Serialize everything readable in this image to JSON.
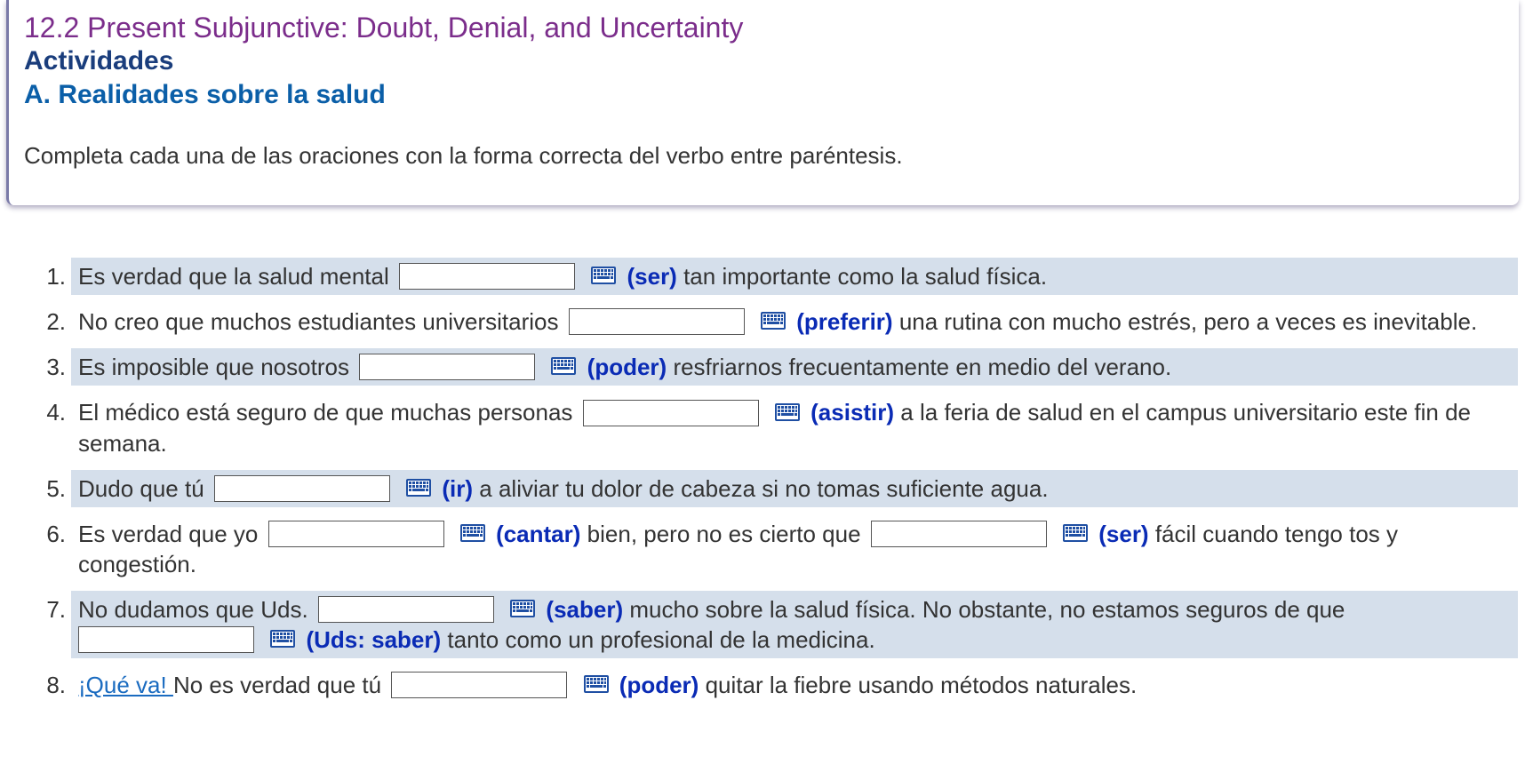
{
  "header": {
    "section_title": "12.2 Present Subjunctive: Doubt, Denial, and Uncertainty",
    "activities_label": "Actividades",
    "activity_title": "A. Realidades sobre la salud",
    "instructions": "Completa cada una de las oraciones con la forma correcta del verbo entre paréntesis."
  },
  "colors": {
    "section_title": "#7b2d8b",
    "activities_heading": "#1a3d7c",
    "activity_title": "#0b5fa8",
    "verb_hint": "#0a2bb5",
    "link": "#1a6bc0",
    "shaded_row": "#d5dfeb"
  },
  "icons": {
    "keyboard": "keyboard-icon"
  },
  "exercises": [
    {
      "number": "1.",
      "text_before": "Es verdad que la salud mental",
      "input1_value": "",
      "hint1": "(ser)",
      "text_after": "tan importante como la salud física."
    },
    {
      "number": "2.",
      "text_before": "No creo que muchos estudiantes universitarios",
      "input1_value": "",
      "hint1": "(preferir)",
      "text_after": "una rutina con mucho estrés, pero a veces es inevitable."
    },
    {
      "number": "3.",
      "text_before": "Es imposible que nosotros",
      "input1_value": "",
      "hint1": "(poder)",
      "text_after": "resfriarnos frecuentamente en medio del verano."
    },
    {
      "number": "4.",
      "text_before": "El médico está seguro de que muchas personas",
      "input1_value": "",
      "hint1": "(asistir)",
      "text_after": "a la feria de salud en el campus universitario este fin de semana."
    },
    {
      "number": "5.",
      "text_before": "Dudo que tú",
      "input1_value": "",
      "hint1": "(ir)",
      "text_after": "a aliviar tu dolor de cabeza si no tomas suficiente agua."
    },
    {
      "number": "6.",
      "text_before": "Es verdad que yo",
      "input1_value": "",
      "hint1": "(cantar)",
      "text_middle": "bien, pero no es cierto que",
      "input2_value": "",
      "hint2": "(ser)",
      "text_after": "fácil cuando tengo tos y congestión."
    },
    {
      "number": "7.",
      "text_before": "No dudamos que Uds.",
      "input1_value": "",
      "hint1": "(saber)",
      "text_middle": "mucho sobre la salud física. No obstante, no estamos seguros de que",
      "input2_value": "",
      "hint2": "(Uds: saber)",
      "text_after": "tanto como un profesional de la medicina."
    },
    {
      "number": "8.",
      "link_text": "¡Qué va! ",
      "text_before": "No es verdad que tú",
      "input1_value": "",
      "hint1": "(poder)",
      "text_after": "quitar la fiebre usando métodos naturales."
    }
  ]
}
